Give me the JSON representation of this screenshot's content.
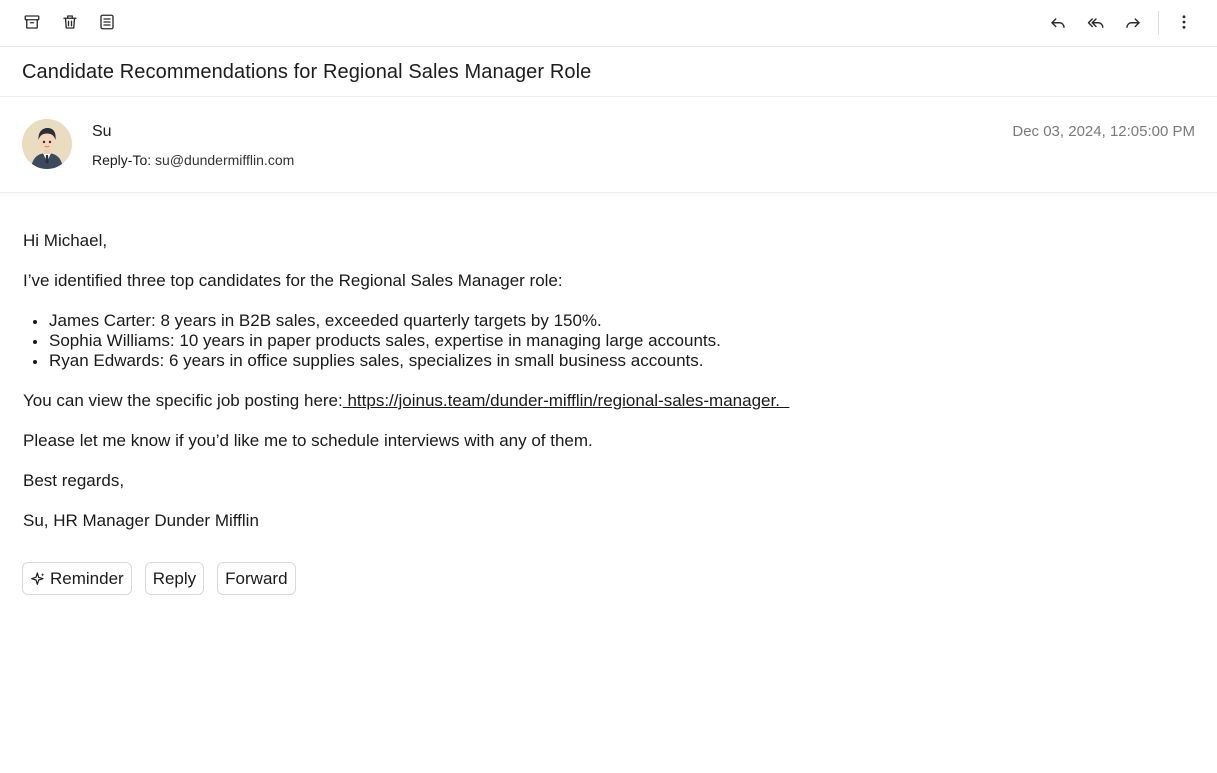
{
  "toolbar": {
    "left_icons": [
      "archive-icon",
      "trash-icon",
      "summary-icon"
    ],
    "right_icons": [
      "reply-icon",
      "reply-all-icon",
      "forward-icon",
      "more-vertical-icon"
    ]
  },
  "email": {
    "subject": "Candidate Recommendations for Regional Sales Manager Role",
    "sender_name": "Su",
    "reply_to_label": "Reply-To:",
    "reply_to_address": "su@dundermifflin.com",
    "date": "Dec 03, 2024, 12:05:00 PM",
    "greeting": "Hi Michael,",
    "intro": "I’ve identified three top candidates for the Regional Sales Manager role:",
    "candidates": [
      "James Carter: 8 years in B2B sales, exceeded quarterly targets by 150%.",
      "Sophia Williams: 10 years in paper products sales, expertise in managing large accounts.",
      "Ryan Edwards: 6 years in office supplies sales, specializes in small business accounts."
    ],
    "posting_text": "You can view the specific job posting here:",
    "posting_link": " https://joinus.team/dunder-mifflin/regional-sales-manager.  ",
    "closing_request": "Please let me know if you’d like me to schedule interviews with any of them.",
    "sign_off": "Best regards,",
    "signature": "Su, HR Manager Dunder Mifflin"
  },
  "actions": {
    "reminder_label": "Reminder",
    "reply_label": "Reply",
    "forward_label": "Forward"
  }
}
